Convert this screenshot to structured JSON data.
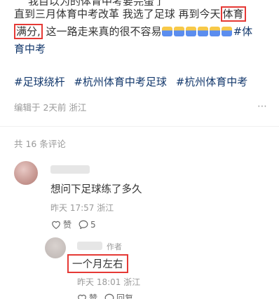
{
  "post": {
    "cut_text": "我目以为的体育中考要完蛋了",
    "line1_before": "直到三月体育中考改革 我选了足球 再到今天",
    "line1_hl": "体育",
    "line2_hl": "满分,",
    "line2_after": " 这一路走来真的很不容易",
    "emoji_name": "sports-emoji",
    "emoji_count": 6,
    "line2_tag": "#体",
    "line3_tag": "育中考",
    "tags": [
      "#足球绕杆",
      "#杭州体育中考足球",
      "#杭州体育中考"
    ],
    "meta": "编辑于 2天前 浙江",
    "more_icon": "more-dots-icon"
  },
  "comments_header": {
    "count_text": "共 16 条评论"
  },
  "comments": [
    {
      "text": "想问下足球练了多久",
      "meta": "昨天 17:57 浙江",
      "like_label": "赞",
      "reply_count": "5"
    },
    {
      "author_badge": "作者",
      "text": "一个月左右",
      "meta": "昨天 18:01 浙江",
      "like_label": "赞",
      "reply_label": "回复"
    }
  ],
  "colors": {
    "highlight_border": "#e53935",
    "hashtag": "#13386c",
    "meta_gray": "#999999"
  }
}
